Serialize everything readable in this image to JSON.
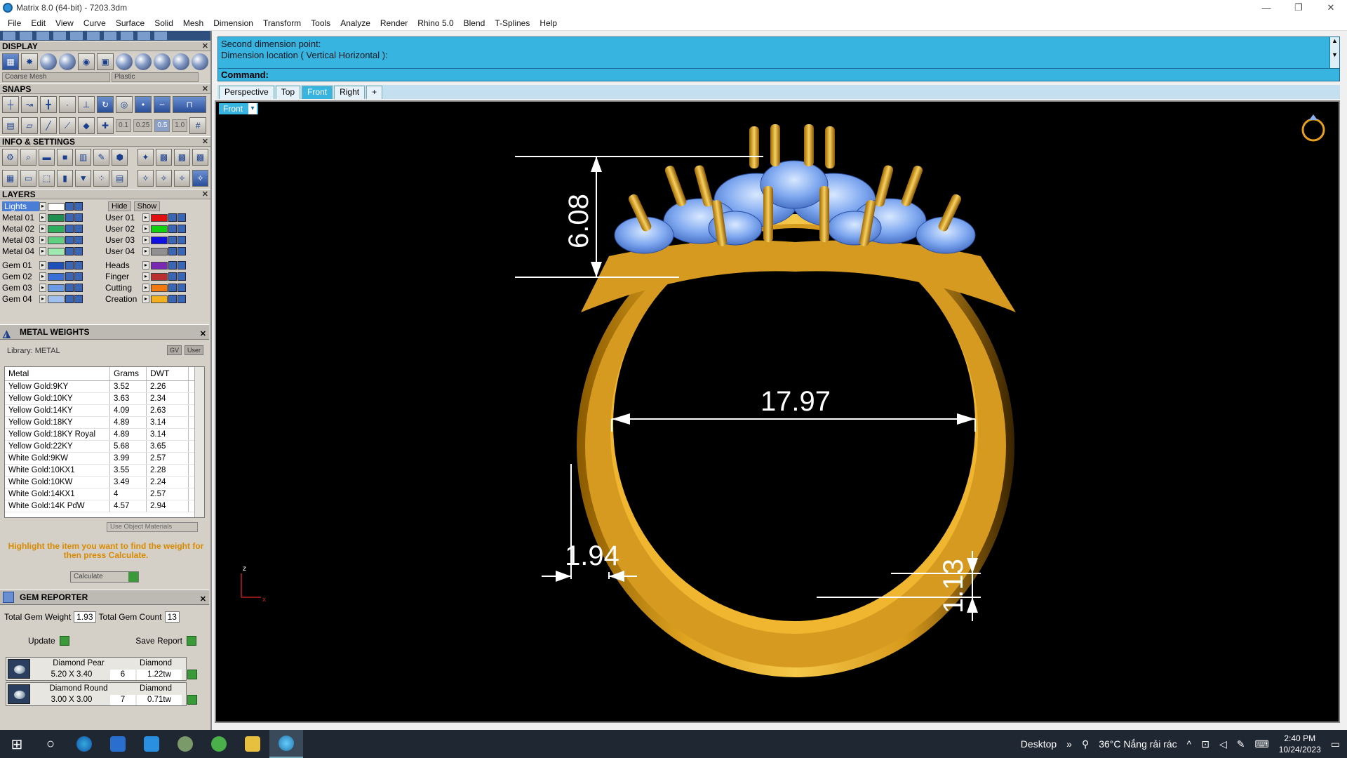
{
  "window": {
    "title": "Matrix 8.0 (64-bit) - 7203.3dm",
    "minimize": "—",
    "restore": "❐",
    "close": "✕"
  },
  "menu": [
    "File",
    "Edit",
    "View",
    "Curve",
    "Surface",
    "Solid",
    "Mesh",
    "Dimension",
    "Transform",
    "Tools",
    "Analyze",
    "Render",
    "Rhino 5.0",
    "Blend",
    "T-Splines",
    "Help"
  ],
  "panels": {
    "display": {
      "title": "DISPLAY",
      "mesh_select": "Coarse Mesh",
      "material_select": "Plastic"
    },
    "snaps": {
      "title": "SNAPS",
      "values": [
        "0.1",
        "0.25",
        "0.5",
        "1.0"
      ]
    },
    "info": {
      "title": "INFO & SETTINGS"
    },
    "layers": {
      "title": "LAYERS",
      "lights": "Lights",
      "hide": "Hide",
      "show": "Show",
      "left": [
        {
          "name": "Metal 01",
          "color": "#1f8f4f"
        },
        {
          "name": "Metal 02",
          "color": "#2eae5e"
        },
        {
          "name": "Metal 03",
          "color": "#5fd07f"
        },
        {
          "name": "Metal 04",
          "color": "#9fe8b0"
        },
        {
          "name": "Gem 01",
          "color": "#1f4fb8"
        },
        {
          "name": "Gem 02",
          "color": "#3a6fd8"
        },
        {
          "name": "Gem 03",
          "color": "#6a9ae8"
        },
        {
          "name": "Gem 04",
          "color": "#a0c0f0"
        }
      ],
      "right": [
        {
          "name": "User 01",
          "color": "#e01010"
        },
        {
          "name": "User 02",
          "color": "#10d010"
        },
        {
          "name": "User 03",
          "color": "#1010e0"
        },
        {
          "name": "User 04",
          "color": "#909090"
        },
        {
          "name": "Heads",
          "color": "#7a2ab0"
        },
        {
          "name": "Finger",
          "color": "#b83030"
        },
        {
          "name": "Cutting",
          "color": "#f07a10"
        },
        {
          "name": "Creation",
          "color": "#f0b020"
        }
      ]
    },
    "metal_weights": {
      "title": "METAL WEIGHTS",
      "library": "Library: METAL",
      "gv": "GV",
      "user": "User",
      "headers": [
        "Metal",
        "Grams",
        "DWT"
      ],
      "rows": [
        [
          "Yellow Gold:9KY",
          "3.52",
          "2.26"
        ],
        [
          "Yellow Gold:10KY",
          "3.63",
          "2.34"
        ],
        [
          "Yellow Gold:14KY",
          "4.09",
          "2.63"
        ],
        [
          "Yellow Gold:18KY",
          "4.89",
          "3.14"
        ],
        [
          "Yellow Gold:18KY Royal",
          "4.89",
          "3.14"
        ],
        [
          "Yellow Gold:22KY",
          "5.68",
          "3.65"
        ],
        [
          "White Gold:9KW",
          "3.99",
          "2.57"
        ],
        [
          "White Gold:10KX1",
          "3.55",
          "2.28"
        ],
        [
          "White Gold:10KW",
          "3.49",
          "2.24"
        ],
        [
          "White Gold:14KX1",
          "4",
          "2.57"
        ],
        [
          "White Gold:14K PdW",
          "4.57",
          "2.94"
        ]
      ],
      "use_object": "Use Object Materials",
      "hint": "Highlight the item you want to find the weight for then press Calculate.",
      "calculate": "Calculate"
    },
    "gem_reporter": {
      "title": "GEM REPORTER",
      "total_weight_label": "Total Gem Weight",
      "total_weight": "1.93",
      "total_count_label": "Total Gem Count",
      "total_count": "13",
      "update": "Update",
      "save_report": "Save Report",
      "gems": [
        {
          "shape": "Diamond Pear",
          "size": "5.20 X 3.40",
          "material": "Diamond",
          "count": "6",
          "weight": "1.22tw"
        },
        {
          "shape": "Diamond Round",
          "size": "3.00 X 3.00",
          "material": "Diamond",
          "count": "7",
          "weight": "0.71tw"
        }
      ]
    }
  },
  "command": {
    "line1": "Second dimension point:",
    "line2": "Dimension location ( Vertical  Horizontal ):",
    "prompt": "Command:"
  },
  "viewtabs": [
    "Perspective",
    "Top",
    "Front",
    "Right",
    "+"
  ],
  "active_view": "Front",
  "dimensions": {
    "height": "6.08",
    "width": "17.97",
    "thickness": "1.94",
    "bottom": "1.13"
  },
  "axis": {
    "z": "z",
    "x": "x"
  },
  "taskbar": {
    "desktop": "Desktop",
    "weather": "36°C  Nắng rải rác",
    "time": "2:40 PM",
    "date": "10/24/2023"
  }
}
